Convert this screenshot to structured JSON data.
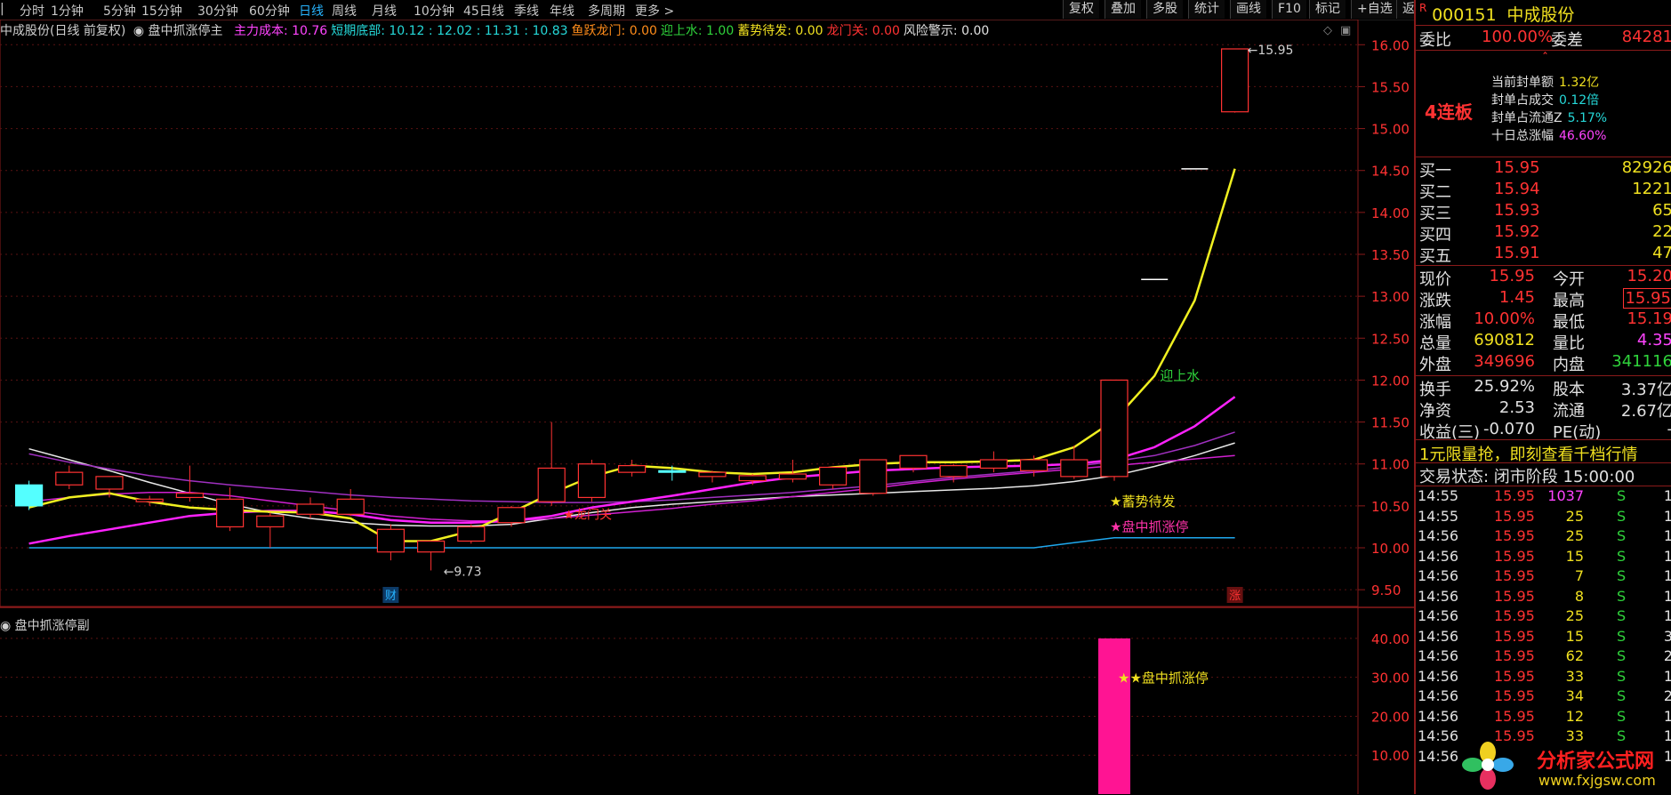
{
  "timeframes": [
    "分时",
    "1分钟",
    "5分钟",
    "15分钟",
    "30分钟",
    "60分钟",
    "日线",
    "周线",
    "月线",
    "10分钟",
    "45日线",
    "季线",
    "年线",
    "多周期",
    "更多"
  ],
  "active_timeframe": "日线",
  "toolbar": [
    "复权",
    "叠加",
    "多股",
    "统计",
    "画线",
    "F10",
    "标记",
    "+自选",
    "返回"
  ],
  "indicator_bar": {
    "title": "中成股份(日线 前复权)",
    "formula": "盘中抓涨停主",
    "items": [
      {
        "label": "主力成本: 10.76",
        "color": "#ff44ff"
      },
      {
        "label": "短期底部: 10.12 : 12.02 : 11.31 : 10.83",
        "color": "#25d8d8"
      },
      {
        "label": "鱼跃龙门: 0.00",
        "color": "#ff8c1a"
      },
      {
        "label": "迎上水: 1.00",
        "color": "#2fd33b"
      },
      {
        "label": "蓄势待发: 0.00",
        "color": "#f0e020"
      },
      {
        "label": "龙门关: 0.00",
        "color": "#ff3232"
      },
      {
        "label": "风险警示: 0.00",
        "color": "#e0e0e0"
      }
    ]
  },
  "chart_data": [
    {
      "type": "candlestick",
      "title": "盘中抓涨停主",
      "ylim": [
        9.3,
        16.3
      ],
      "yticks": [
        9.5,
        10.0,
        10.5,
        11.0,
        11.5,
        12.0,
        12.5,
        13.0,
        13.5,
        14.0,
        14.5,
        15.0,
        15.5,
        16.0
      ],
      "candles": [
        {
          "o": 10.75,
          "h": 10.8,
          "l": 10.45,
          "c": 10.5
        },
        {
          "o": 10.75,
          "h": 10.98,
          "l": 10.7,
          "c": 10.9
        },
        {
          "o": 10.7,
          "h": 10.85,
          "l": 10.6,
          "c": 10.85
        },
        {
          "o": 10.55,
          "h": 10.62,
          "l": 10.5,
          "c": 10.58
        },
        {
          "o": 10.6,
          "h": 10.98,
          "l": 10.55,
          "c": 10.65
        },
        {
          "o": 10.25,
          "h": 10.72,
          "l": 10.2,
          "c": 10.58
        },
        {
          "o": 10.25,
          "h": 10.42,
          "l": 10.0,
          "c": 10.38
        },
        {
          "o": 10.4,
          "h": 10.6,
          "l": 10.35,
          "c": 10.52
        },
        {
          "o": 10.4,
          "h": 10.7,
          "l": 10.38,
          "c": 10.58
        },
        {
          "o": 9.95,
          "h": 10.28,
          "l": 9.85,
          "c": 10.22
        },
        {
          "o": 9.95,
          "h": 10.08,
          "l": 9.73,
          "c": 10.08
        },
        {
          "o": 10.08,
          "h": 10.28,
          "l": 10.05,
          "c": 10.25
        },
        {
          "o": 10.3,
          "h": 10.5,
          "l": 10.25,
          "c": 10.48
        },
        {
          "o": 10.55,
          "h": 11.5,
          "l": 10.5,
          "c": 10.95
        },
        {
          "o": 10.6,
          "h": 11.05,
          "l": 10.55,
          "c": 11.0
        },
        {
          "o": 10.9,
          "h": 11.05,
          "l": 10.85,
          "c": 10.98
        },
        {
          "o": 10.92,
          "h": 10.98,
          "l": 10.8,
          "c": 10.9
        },
        {
          "o": 10.85,
          "h": 10.92,
          "l": 10.78,
          "c": 10.9
        },
        {
          "o": 10.8,
          "h": 10.88,
          "l": 10.75,
          "c": 10.86
        },
        {
          "o": 10.82,
          "h": 11.05,
          "l": 10.78,
          "c": 10.88
        },
        {
          "o": 10.75,
          "h": 10.95,
          "l": 10.7,
          "c": 10.96
        },
        {
          "o": 10.65,
          "h": 11.05,
          "l": 10.62,
          "c": 11.05
        },
        {
          "o": 10.95,
          "h": 11.1,
          "l": 10.9,
          "c": 11.1
        },
        {
          "o": 10.85,
          "h": 11.0,
          "l": 10.78,
          "c": 10.98
        },
        {
          "o": 10.95,
          "h": 11.15,
          "l": 10.9,
          "c": 11.05
        },
        {
          "o": 10.92,
          "h": 11.1,
          "l": 10.85,
          "c": 11.05
        },
        {
          "o": 10.85,
          "h": 11.22,
          "l": 10.82,
          "c": 11.05
        },
        {
          "o": 10.85,
          "h": 12.0,
          "l": 10.8,
          "c": 12.0
        },
        {
          "o": 13.2,
          "h": 13.2,
          "l": 13.2,
          "c": 13.2
        },
        {
          "o": 14.52,
          "h": 14.52,
          "l": 14.52,
          "c": 14.52
        },
        {
          "o": 15.2,
          "h": 15.95,
          "l": 15.19,
          "c": 15.95
        }
      ],
      "series": [
        {
          "name": "白线",
          "color": "#e8e8e8",
          "values": [
            11.18,
            11.05,
            10.92,
            10.78,
            10.65,
            10.52,
            10.42,
            10.35,
            10.3,
            10.27,
            10.26,
            10.26,
            10.28,
            10.35,
            10.42,
            10.48,
            10.52,
            10.55,
            10.58,
            10.61,
            10.63,
            10.65,
            10.67,
            10.69,
            10.71,
            10.74,
            10.79,
            10.86,
            10.97,
            11.1,
            11.25
          ]
        },
        {
          "name": "粉线",
          "color": "#d020d0",
          "values": [
            10.55,
            10.6,
            10.64,
            10.66,
            10.66,
            10.62,
            10.56,
            10.5,
            10.44,
            10.38,
            10.34,
            10.32,
            10.32,
            10.35,
            10.39,
            10.43,
            10.47,
            10.52,
            10.56,
            10.61,
            10.66,
            10.71,
            10.77,
            10.82,
            10.86,
            10.9,
            10.94,
            10.98,
            11.02,
            11.06,
            11.1
          ]
        },
        {
          "name": "紫线",
          "color": "#a030c0",
          "values": [
            11.12,
            11.02,
            10.94,
            10.86,
            10.8,
            10.75,
            10.71,
            10.67,
            10.63,
            10.6,
            10.58,
            10.56,
            10.55,
            10.54,
            10.54,
            10.55,
            10.57,
            10.6,
            10.63,
            10.66,
            10.7,
            10.74,
            10.79,
            10.84,
            10.88,
            10.92,
            10.97,
            11.03,
            11.1,
            11.22,
            11.38
          ]
        },
        {
          "name": "粗紫线",
          "color": "#ff22ff",
          "values": [
            10.05,
            10.14,
            10.22,
            10.3,
            10.38,
            10.42,
            10.44,
            10.44,
            10.4,
            10.33,
            10.3,
            10.3,
            10.32,
            10.38,
            10.48,
            10.55,
            10.62,
            10.7,
            10.78,
            10.84,
            10.88,
            10.92,
            10.94,
            10.96,
            10.97,
            10.98,
            11.0,
            11.05,
            11.2,
            11.45,
            11.8
          ]
        },
        {
          "name": "黄线",
          "color": "#f0f020",
          "values": [
            10.48,
            10.6,
            10.65,
            10.55,
            10.48,
            10.45,
            10.43,
            10.42,
            10.35,
            10.08,
            10.08,
            10.2,
            10.42,
            10.65,
            10.85,
            10.98,
            10.95,
            10.9,
            10.88,
            10.9,
            10.96,
            11.0,
            11.02,
            11.02,
            11.03,
            11.05,
            11.2,
            11.52,
            12.05,
            12.95,
            14.52
          ]
        },
        {
          "name": "蓝线",
          "color": "#1fa8ee",
          "values": [
            10.0,
            10.0,
            10.0,
            10.0,
            10.0,
            10.0,
            10.0,
            10.0,
            10.0,
            10.0,
            10.0,
            10.0,
            10.0,
            10.0,
            10.0,
            10.0,
            10.0,
            10.0,
            10.0,
            10.0,
            10.0,
            10.0,
            10.0,
            10.0,
            10.0,
            10.0,
            10.06,
            10.12,
            10.12,
            10.12,
            10.12
          ]
        }
      ],
      "annotations": [
        {
          "text": "15.95",
          "type": "price-high"
        },
        {
          "text": "9.73",
          "type": "price-low"
        },
        {
          "text": "迎上水",
          "color": "#2fd33b"
        },
        {
          "text": "★蓄势待发",
          "color": "#f0e020"
        },
        {
          "text": "★盘中抓涨停",
          "color": "#ff33aa"
        },
        {
          "text": "★龙门关",
          "color": "#ff3232"
        },
        {
          "text": "财",
          "color": "#27b4ff"
        },
        {
          "text": "涨",
          "color": "#ff3232"
        }
      ]
    },
    {
      "type": "bar",
      "title": "盘中抓涨停副",
      "ylim": [
        0,
        45
      ],
      "yticks": [
        10.0,
        20.0,
        30.0,
        40.0
      ],
      "values": [
        0,
        0,
        0,
        0,
        0,
        0,
        0,
        0,
        0,
        0,
        0,
        0,
        0,
        0,
        0,
        0,
        0,
        0,
        0,
        0,
        0,
        0,
        0,
        0,
        0,
        0,
        0,
        40,
        0,
        0,
        0
      ],
      "annotation": "★★盘中抓涨停"
    }
  ],
  "stock": {
    "code": "000151",
    "name": "中成股份",
    "weibi_label": "委比",
    "weibi": "100.00%",
    "weicha_label": "委差",
    "weicha": "84281",
    "streak": "4连板",
    "seal_info": [
      {
        "label": "当前封单额",
        "value": "1.32亿",
        "color": "#f0e020"
      },
      {
        "label": "封单占成交",
        "value": "0.12倍",
        "color": "#25d8d8"
      },
      {
        "label": "封单占流通Z",
        "value": "5.17%",
        "color": "#25d8d8"
      },
      {
        "label": "十日总涨幅",
        "value": "46.60%",
        "color": "#ff44ff"
      }
    ],
    "bids": [
      {
        "label": "买一",
        "price": "15.95",
        "vol": "82926"
      },
      {
        "label": "买二",
        "price": "15.94",
        "vol": "1221"
      },
      {
        "label": "买三",
        "price": "15.93",
        "vol": "65"
      },
      {
        "label": "买四",
        "price": "15.92",
        "vol": "22"
      },
      {
        "label": "买五",
        "price": "15.91",
        "vol": "47"
      }
    ],
    "quote": [
      {
        "l": "现价",
        "lv": "15.95",
        "lc": "#ff3232",
        "r": "今开",
        "rv": "15.20",
        "rc": "#ff3232"
      },
      {
        "l": "涨跌",
        "lv": "1.45",
        "lc": "#ff3232",
        "r": "最高",
        "rv": "15.95",
        "rc": "#ff3232"
      },
      {
        "l": "涨幅",
        "lv": "10.00%",
        "lc": "#ff3232",
        "r": "最低",
        "rv": "15.19",
        "rc": "#ff3232"
      },
      {
        "l": "总量",
        "lv": "690812",
        "lc": "#f0e020",
        "r": "量比",
        "rv": "4.35",
        "rc": "#ff44ff"
      },
      {
        "l": "外盘",
        "lv": "349696",
        "lc": "#ff3232",
        "r": "内盘",
        "rv": "341116",
        "rc": "#2fd33b"
      },
      {
        "l": "换手",
        "lv": "25.92%",
        "lc": "#e0e0e0",
        "r": "股本",
        "rv": "3.37亿",
        "rc": "#e0e0e0"
      },
      {
        "l": "净资",
        "lv": "2.53",
        "lc": "#e0e0e0",
        "r": "流通",
        "rv": "2.67亿",
        "rc": "#e0e0e0"
      },
      {
        "l": "收益(三)",
        "lv": "-0.070",
        "lc": "#e0e0e0",
        "r": "PE(动)",
        "rv": "-",
        "rc": "#e0e0e0"
      }
    ],
    "promo": "1元限量抢，即刻查看千档行情",
    "trade_status": "交易状态: 闭市阶段 15:00:00",
    "ticks": [
      {
        "t": "14:55",
        "p": "15.95",
        "v": "1037",
        "s": "S",
        "x": "1",
        "vc": "#ff44ff"
      },
      {
        "t": "14:55",
        "p": "15.95",
        "v": "25",
        "s": "S",
        "x": "1",
        "vc": "#f0e020"
      },
      {
        "t": "14:56",
        "p": "15.95",
        "v": "25",
        "s": "S",
        "x": "1",
        "vc": "#f0e020"
      },
      {
        "t": "14:56",
        "p": "15.95",
        "v": "15",
        "s": "S",
        "x": "1",
        "vc": "#f0e020"
      },
      {
        "t": "14:56",
        "p": "15.95",
        "v": "7",
        "s": "S",
        "x": "1",
        "vc": "#f0e020"
      },
      {
        "t": "14:56",
        "p": "15.95",
        "v": "8",
        "s": "S",
        "x": "1",
        "vc": "#f0e020"
      },
      {
        "t": "14:56",
        "p": "15.95",
        "v": "25",
        "s": "S",
        "x": "1",
        "vc": "#f0e020"
      },
      {
        "t": "14:56",
        "p": "15.95",
        "v": "15",
        "s": "S",
        "x": "3",
        "vc": "#f0e020"
      },
      {
        "t": "14:56",
        "p": "15.95",
        "v": "62",
        "s": "S",
        "x": "2",
        "vc": "#f0e020"
      },
      {
        "t": "14:56",
        "p": "15.95",
        "v": "33",
        "s": "S",
        "x": "1",
        "vc": "#f0e020"
      },
      {
        "t": "14:56",
        "p": "15.95",
        "v": "34",
        "s": "S",
        "x": "2",
        "vc": "#f0e020"
      },
      {
        "t": "14:56",
        "p": "15.95",
        "v": "12",
        "s": "S",
        "x": "1",
        "vc": "#f0e020"
      },
      {
        "t": "14:56",
        "p": "15.95",
        "v": "33",
        "s": "S",
        "x": "1",
        "vc": "#f0e020"
      },
      {
        "t": "14:56",
        "p": "",
        "v": "",
        "s": "",
        "x": "1",
        "vc": "#f0e020"
      }
    ]
  },
  "watermark": {
    "name": "分析家公式网",
    "url": "www.fxjgsw.com"
  }
}
